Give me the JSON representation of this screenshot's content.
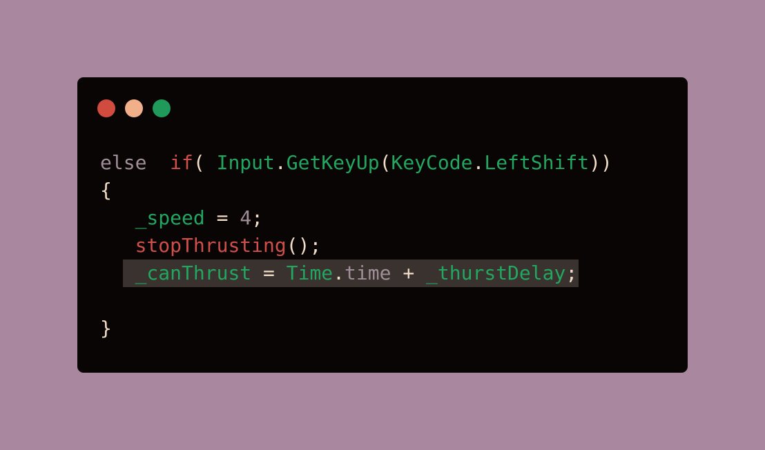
{
  "window": {
    "buttons": [
      {
        "name": "close",
        "color": "#d24b3f"
      },
      {
        "name": "minimize",
        "color": "#f2b08a"
      },
      {
        "name": "maximize",
        "color": "#1f9a5a"
      }
    ]
  },
  "colors": {
    "background": "#a9889f",
    "editor": "#0a0505",
    "highlight": "#3a322f",
    "keyword": "#a08e98",
    "control": "#cf4f4a",
    "type": "#23a65f",
    "text": "#f2ddc7"
  },
  "code": {
    "lines": [
      [
        {
          "text": "else",
          "kind": "keyword"
        },
        {
          "text": "  ",
          "kind": "punct"
        },
        {
          "text": "if",
          "kind": "control"
        },
        {
          "text": "( ",
          "kind": "punct"
        },
        {
          "text": "Input",
          "kind": "type"
        },
        {
          "text": ".",
          "kind": "punct"
        },
        {
          "text": "GetKeyUp",
          "kind": "type"
        },
        {
          "text": "(",
          "kind": "punct"
        },
        {
          "text": "KeyCode",
          "kind": "type"
        },
        {
          "text": ".",
          "kind": "punct"
        },
        {
          "text": "LeftShift",
          "kind": "type"
        },
        {
          "text": "))",
          "kind": "punct"
        }
      ],
      [
        {
          "text": "{",
          "kind": "punct"
        }
      ],
      [
        {
          "text": "   ",
          "kind": "punct"
        },
        {
          "text": "_speed",
          "kind": "type"
        },
        {
          "text": " = ",
          "kind": "punct"
        },
        {
          "text": "4",
          "kind": "number"
        },
        {
          "text": ";",
          "kind": "punct"
        }
      ],
      [
        {
          "text": "   ",
          "kind": "punct"
        },
        {
          "text": "stopThrusting",
          "kind": "call"
        },
        {
          "text": "();",
          "kind": "punct"
        }
      ],
      [
        {
          "text": "   ",
          "kind": "punct"
        },
        {
          "text": "_canThrust",
          "kind": "type",
          "highlight": true
        },
        {
          "text": " = ",
          "kind": "punct",
          "highlight": true
        },
        {
          "text": "Time",
          "kind": "type",
          "highlight": true
        },
        {
          "text": ".",
          "kind": "punct",
          "highlight": true
        },
        {
          "text": "time",
          "kind": "prop",
          "highlight": true
        },
        {
          "text": " + ",
          "kind": "punct",
          "highlight": true
        },
        {
          "text": "_thurstDelay",
          "kind": "type",
          "highlight": true
        },
        {
          "text": ";",
          "kind": "punct",
          "highlight": true
        }
      ],
      [],
      [
        {
          "text": "}",
          "kind": "punct"
        }
      ]
    ]
  }
}
